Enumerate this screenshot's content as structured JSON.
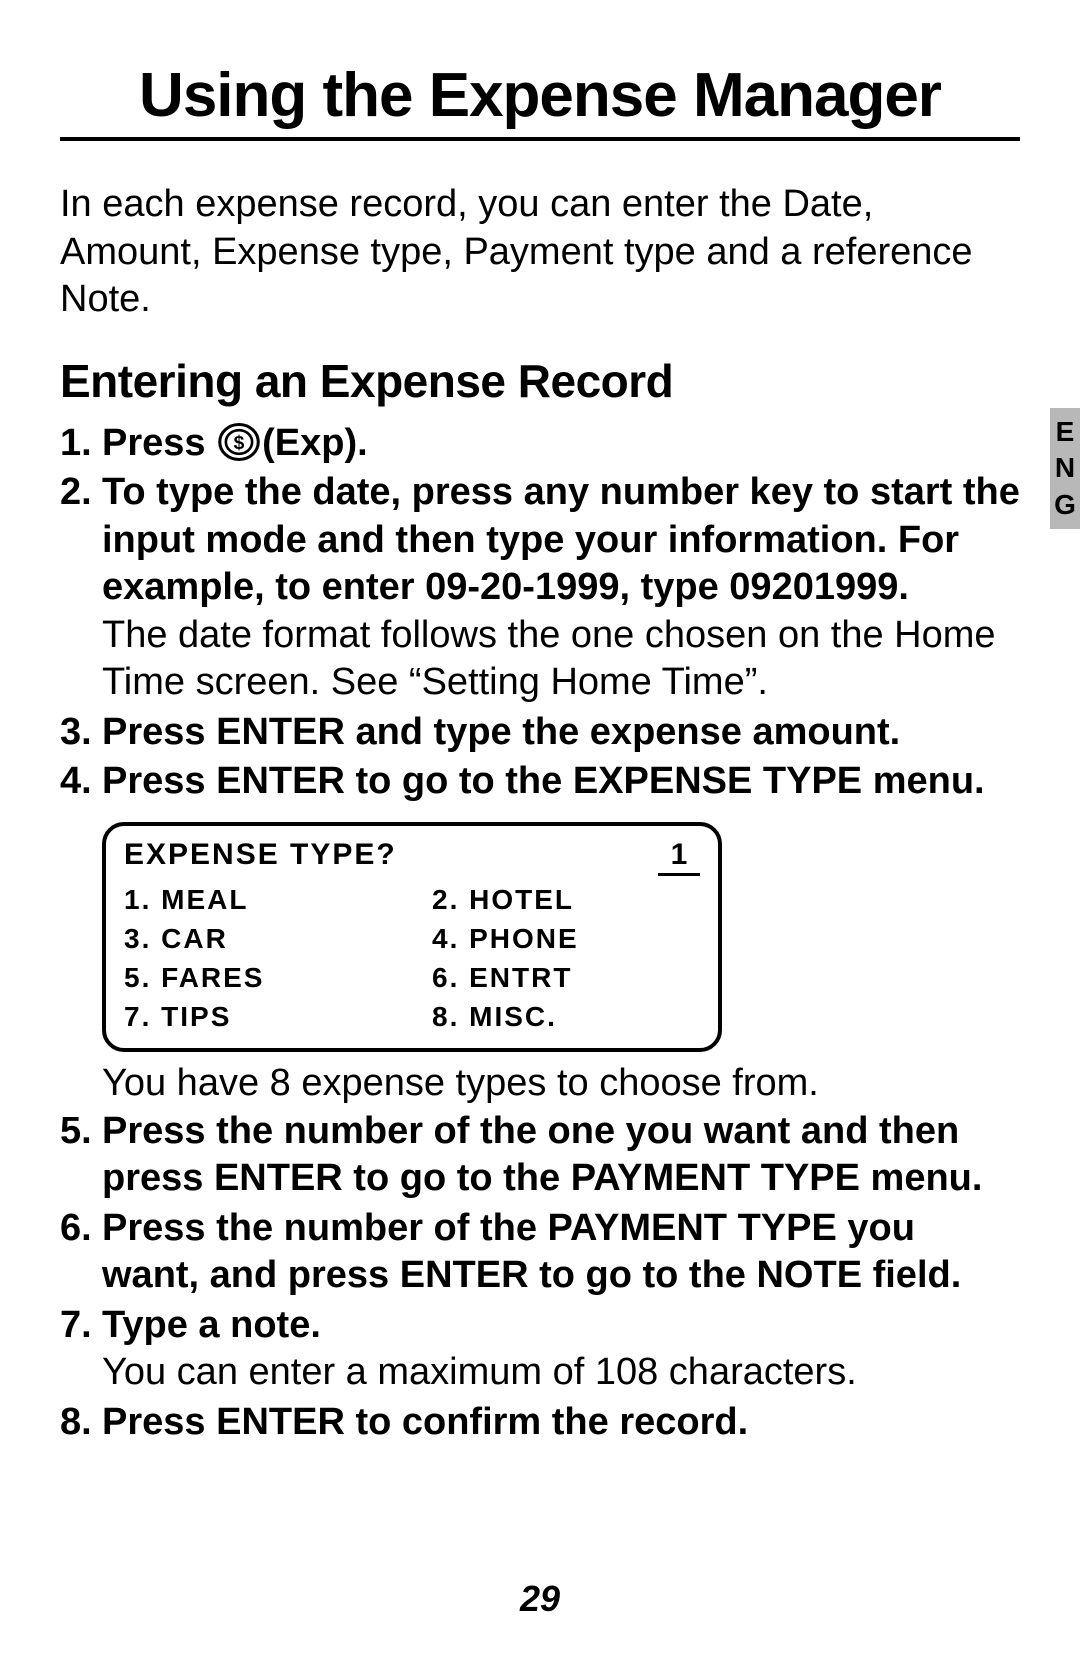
{
  "title": "Using the Expense Manager",
  "intro": "In each expense record, you can enter the Date, Amount, Expense type, Payment type and a reference Note.",
  "subhead": "Entering an Expense Record",
  "steps": {
    "s1_pre": "Press ",
    "s1_post": "(Exp).",
    "s2_bold": "To type the date, press any number key to start the input mode and then type your information. For example, to enter 09-20-1999, type 09201999.",
    "s2_norm": "The date format follows the one chosen on the Home Time screen. See “Setting Home Time”.",
    "s3": "Press ENTER and type the expense amount.",
    "s4": "Press ENTER to go to the EXPENSE TYPE menu.",
    "s4_after": "You have 8 expense types to choose from.",
    "s5": "Press the number of the one you want and then press ENTER to go to the PAYMENT TYPE menu.",
    "s6": "Press the number of the PAYMENT TYPE you want, and press ENTER to go to the NOTE field.",
    "s7_bold": "Type a note.",
    "s7_norm": "You can enter a maximum of 108 characters.",
    "s8": "Press ENTER to confirm the record."
  },
  "nums": {
    "n1": "1.",
    "n2": "2.",
    "n3": "3.",
    "n4": "4.",
    "n5": "5.",
    "n6": "6.",
    "n7": "7.",
    "n8": "8."
  },
  "lcd": {
    "title": "EXPENSE TYPE?",
    "slot": "1",
    "items": [
      "1. MEAL",
      "2. HOTEL",
      "3. CAR",
      "4. PHONE",
      "5. FARES",
      "6. ENTRT",
      "7. TIPS",
      "8. MISC."
    ]
  },
  "lang_tab": {
    "l1": "E",
    "l2": "N",
    "l3": "G"
  },
  "page_number": "29"
}
